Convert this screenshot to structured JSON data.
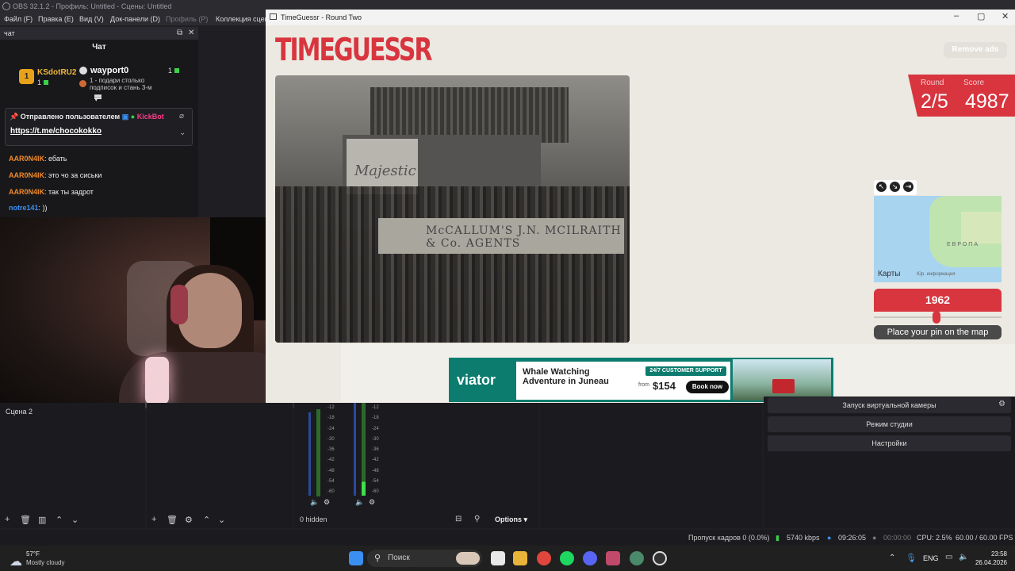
{
  "obs": {
    "title": "OBS 32.1.2 - Профиль: Untitled - Сцены: Untitled",
    "menu": [
      "Файл (F)",
      "Правка (E)",
      "Вид (V)",
      "Док-панели (D)",
      "Профиль (P)",
      "Коллекция сцен"
    ]
  },
  "chat": {
    "dock_title": "чат",
    "header": "Чат",
    "top1": {
      "rank": "1",
      "name": "KSdotRU2",
      "count": "1"
    },
    "top2": {
      "name": "wayport0",
      "count": "1",
      "desc": "1 - подари столько подписок и стань 3-м"
    },
    "pinned": {
      "label": "Отправлено пользователем",
      "bot": "KickBot",
      "link": "https://t.me/chocokokko"
    },
    "messages": [
      {
        "user": "AAR0N4IK",
        "text": ": ебать"
      },
      {
        "user": "AAR0N4IK",
        "text": ": это чо за сиськи"
      },
      {
        "user": "AAR0N4IK",
        "text": ": так ты задрот"
      },
      {
        "user": "notre141",
        "text": ": ))"
      }
    ]
  },
  "timeguessr": {
    "window_title": "TimeGuessr - Round Two",
    "logo": "TIMEGUESSR",
    "remove_ads": "Remove ads",
    "round_label": "Round",
    "round_value": "2/5",
    "score_label": "Score",
    "score_value": "4987",
    "photo_text1": "Majestic",
    "photo_text2": "McCALLUM'S      J.N. MCILRAITH & Co. AGENTS",
    "map": {
      "region": "ЕВРОПА",
      "brand": "Карты",
      "legal": "Юр. информация"
    },
    "year": "1962",
    "year_fraction": 0.49,
    "pin_button": "Place your pin on the map"
  },
  "ad": {
    "brand": "viator",
    "headline": "Whale Watching Adventure in Juneau",
    "support": "24/7 CUSTOMER SUPPORT",
    "from": "from",
    "price": "$154",
    "cta": "Book now"
  },
  "obs_bottom": {
    "scene": "Сцена 2",
    "hidden": "0 hidden",
    "options": "Options",
    "controls": [
      "Запуск виртуальной камеры",
      "Режим студии",
      "Настройки"
    ],
    "scale": [
      "-12",
      "-18",
      "-24",
      "-30",
      "-36",
      "-42",
      "-48",
      "-54",
      "-60"
    ]
  },
  "status": {
    "dropped": "Пропуск кадров 0 (0.0%)",
    "bitrate": "5740 kbps",
    "stream_time": "09:26:05",
    "rec_time": "00:00:00",
    "cpu": "CPU: 2.5%",
    "fps": "60.00 / 60.00 FPS"
  },
  "taskbar": {
    "temp": "57°F",
    "weather": "Mostly cloudy",
    "search": "Поиск",
    "lang": "ENG",
    "time": "23:58",
    "date": "26.04.2026"
  }
}
